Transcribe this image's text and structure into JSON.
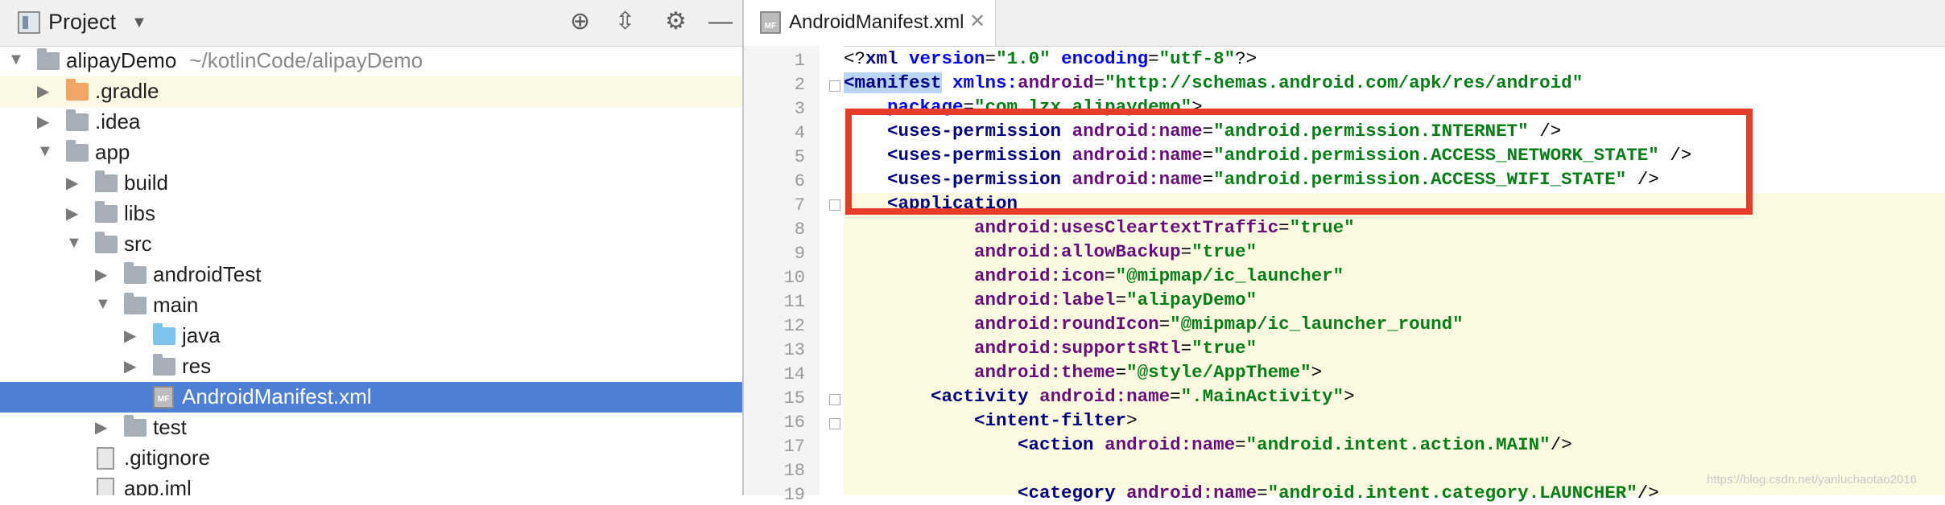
{
  "project_panel": {
    "title": "Project",
    "root": {
      "name": "alipayDemo",
      "path": "~/kotlinCode/alipayDemo"
    },
    "items": [
      {
        "label": ".gradle",
        "icon": "folder-orange"
      },
      {
        "label": ".idea",
        "icon": "folder"
      },
      {
        "label": "app",
        "icon": "module-folder"
      },
      {
        "label": "build",
        "icon": "folder"
      },
      {
        "label": "libs",
        "icon": "folder"
      },
      {
        "label": "src",
        "icon": "folder"
      },
      {
        "label": "androidTest",
        "icon": "folder"
      },
      {
        "label": "main",
        "icon": "folder"
      },
      {
        "label": "java",
        "icon": "folder-blue"
      },
      {
        "label": "res",
        "icon": "resource-folder"
      },
      {
        "label": "AndroidManifest.xml",
        "icon": "manifest-file"
      },
      {
        "label": "test",
        "icon": "folder"
      },
      {
        "label": ".gitignore",
        "icon": "file"
      },
      {
        "label": "app.iml",
        "icon": "file"
      }
    ],
    "selected": "AndroidManifest.xml"
  },
  "editor": {
    "tab": {
      "label": "AndroidManifest.xml",
      "icon_text": "MF"
    },
    "lines": [
      {
        "n": "1",
        "parts": [
          [
            "pun",
            "<?"
          ],
          [
            "tag",
            "xml "
          ],
          [
            "attrb",
            "version"
          ],
          [
            "pun",
            "="
          ],
          [
            "val",
            "\"1.0\""
          ],
          [
            "pun",
            " "
          ],
          [
            "attrb",
            "encoding"
          ],
          [
            "pun",
            "="
          ],
          [
            "val",
            "\"utf-8\""
          ],
          [
            "pun",
            "?>"
          ]
        ]
      },
      {
        "n": "2",
        "parts": [
          [
            "hl",
            "<manifest"
          ],
          [
            "pun",
            " "
          ],
          [
            "attrb",
            "xmlns:"
          ],
          [
            "attr",
            "android"
          ],
          [
            "pun",
            "="
          ],
          [
            "val",
            "\"http://schemas.android.com/apk/res/android\""
          ]
        ]
      },
      {
        "n": "3",
        "parts": [
          [
            "pun",
            "    "
          ],
          [
            "attrb",
            "package"
          ],
          [
            "pun",
            "="
          ],
          [
            "val",
            "\"com.lzx.alipaydemo\""
          ],
          [
            "pun",
            ">"
          ]
        ]
      },
      {
        "n": "4",
        "parts": [
          [
            "pun",
            "    "
          ],
          [
            "tag",
            "<uses-permission "
          ],
          [
            "attr",
            "android:name"
          ],
          [
            "pun",
            "="
          ],
          [
            "val",
            "\"android.permission.INTERNET\""
          ],
          [
            "pun",
            " />"
          ]
        ]
      },
      {
        "n": "5",
        "parts": [
          [
            "pun",
            "    "
          ],
          [
            "tag",
            "<uses-permission "
          ],
          [
            "attr",
            "android:name"
          ],
          [
            "pun",
            "="
          ],
          [
            "val",
            "\"android.permission.ACCESS_NETWORK_STATE\""
          ],
          [
            "pun",
            " />"
          ]
        ]
      },
      {
        "n": "6",
        "parts": [
          [
            "pun",
            "    "
          ],
          [
            "tag",
            "<uses-permission "
          ],
          [
            "attr",
            "android:name"
          ],
          [
            "pun",
            "="
          ],
          [
            "val",
            "\"android.permission.ACCESS_WIFI_STATE\""
          ],
          [
            "pun",
            " />"
          ]
        ]
      },
      {
        "n": "7",
        "parts": [
          [
            "pun",
            "    "
          ],
          [
            "tag",
            "<application"
          ]
        ]
      },
      {
        "n": "8",
        "parts": [
          [
            "pun",
            "            "
          ],
          [
            "attr",
            "android:usesCleartextTraffic"
          ],
          [
            "pun",
            "="
          ],
          [
            "val",
            "\"true\""
          ]
        ]
      },
      {
        "n": "9",
        "parts": [
          [
            "pun",
            "            "
          ],
          [
            "attr",
            "android:allowBackup"
          ],
          [
            "pun",
            "="
          ],
          [
            "val",
            "\"true\""
          ]
        ]
      },
      {
        "n": "10",
        "parts": [
          [
            "pun",
            "            "
          ],
          [
            "attr",
            "android:icon"
          ],
          [
            "pun",
            "="
          ],
          [
            "val",
            "\"@mipmap/ic_launcher\""
          ]
        ]
      },
      {
        "n": "11",
        "parts": [
          [
            "pun",
            "            "
          ],
          [
            "attr",
            "android:label"
          ],
          [
            "pun",
            "="
          ],
          [
            "val",
            "\"alipayDemo\""
          ]
        ]
      },
      {
        "n": "12",
        "parts": [
          [
            "pun",
            "            "
          ],
          [
            "attr",
            "android:roundIcon"
          ],
          [
            "pun",
            "="
          ],
          [
            "val",
            "\"@mipmap/ic_launcher_round\""
          ]
        ]
      },
      {
        "n": "13",
        "parts": [
          [
            "pun",
            "            "
          ],
          [
            "attr",
            "android:supportsRtl"
          ],
          [
            "pun",
            "="
          ],
          [
            "val",
            "\"true\""
          ]
        ]
      },
      {
        "n": "14",
        "parts": [
          [
            "pun",
            "            "
          ],
          [
            "attr",
            "android:theme"
          ],
          [
            "pun",
            "="
          ],
          [
            "val",
            "\"@style/AppTheme\""
          ],
          [
            "pun",
            ">"
          ]
        ]
      },
      {
        "n": "15",
        "parts": [
          [
            "pun",
            "        "
          ],
          [
            "tag",
            "<activity "
          ],
          [
            "attr",
            "android:name"
          ],
          [
            "pun",
            "="
          ],
          [
            "val",
            "\".MainActivity\""
          ],
          [
            "pun",
            ">"
          ]
        ]
      },
      {
        "n": "16",
        "parts": [
          [
            "pun",
            "            "
          ],
          [
            "tag",
            "<intent-filter"
          ],
          [
            "pun",
            ">"
          ]
        ]
      },
      {
        "n": "17",
        "parts": [
          [
            "pun",
            "                "
          ],
          [
            "tag",
            "<action "
          ],
          [
            "attr",
            "android:name"
          ],
          [
            "pun",
            "="
          ],
          [
            "val",
            "\"android.intent.action.MAIN\""
          ],
          [
            "pun",
            "/>"
          ]
        ]
      },
      {
        "n": "18",
        "parts": []
      },
      {
        "n": "19",
        "parts": [
          [
            "pun",
            "                "
          ],
          [
            "tag",
            "<category "
          ],
          [
            "attr",
            "android:name"
          ],
          [
            "pun",
            "="
          ],
          [
            "val",
            "\"android.intent.category.LAUNCHER\""
          ],
          [
            "pun",
            "/>"
          ]
        ]
      }
    ]
  },
  "watermark": "https://blog.csdn.net/yanluchaotao2016",
  "colors": {
    "selection": "#4e7fd4",
    "annotation_box": "#e83c2b",
    "line_highlight": "#fcf9e1"
  }
}
